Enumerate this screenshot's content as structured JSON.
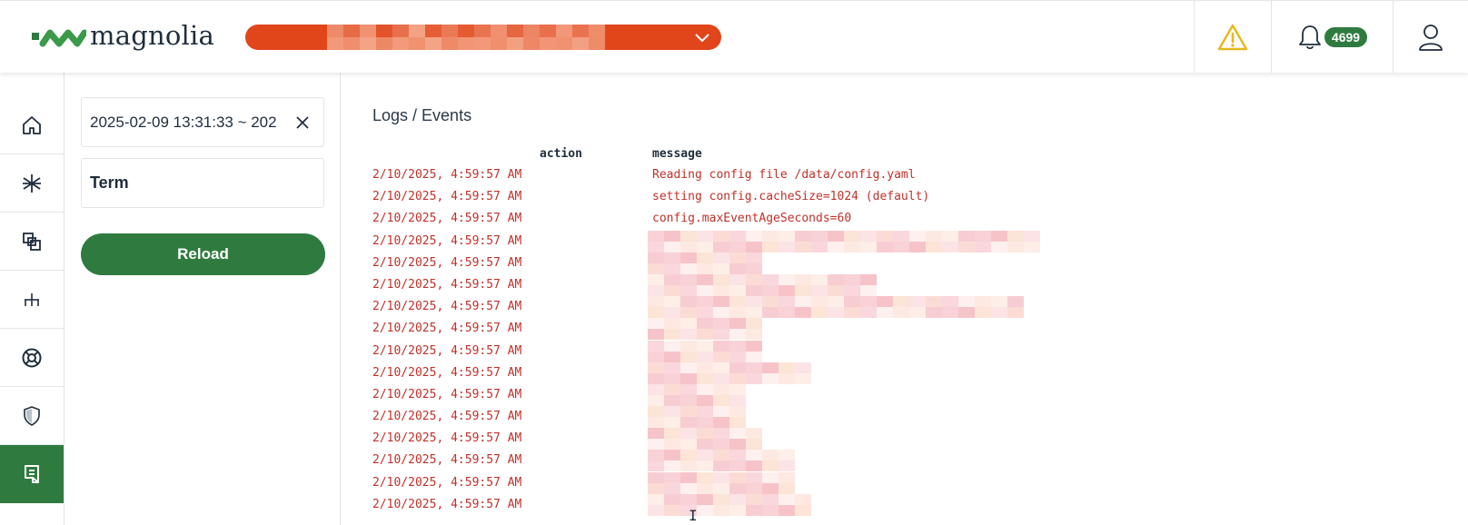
{
  "header": {
    "logo_text": "magnolia",
    "notifications_count": "4699",
    "accent_color": "#2f7b3f",
    "selector_color": "#e1451a",
    "warning_color": "#e5b81a"
  },
  "nav": {
    "items": [
      {
        "icon": "home-icon"
      },
      {
        "icon": "asterisk-icon"
      },
      {
        "icon": "overlap-squares-icon"
      },
      {
        "icon": "hierarchy-icon"
      },
      {
        "icon": "lifebuoy-icon"
      },
      {
        "icon": "shield-icon"
      },
      {
        "icon": "logs-icon",
        "active": true
      }
    ]
  },
  "filters": {
    "date_range": "2025-02-09 13:31:33 ~ 202",
    "term_placeholder": "Term",
    "reload_label": "Reload"
  },
  "main": {
    "breadcrumb": "Logs / Events",
    "columns": {
      "action": "action",
      "message": "message"
    },
    "rows": [
      {
        "timestamp": "2/10/2025, 4:59:57 AM",
        "message": "Reading config file /data/config.yaml"
      },
      {
        "timestamp": "2/10/2025, 4:59:57 AM",
        "message": "setting config.cacheSize=1024 (default)"
      },
      {
        "timestamp": "2/10/2025, 4:59:57 AM",
        "message": "config.maxEventAgeSeconds=60"
      },
      {
        "timestamp": "2/10/2025, 4:59:57 AM",
        "message": ""
      },
      {
        "timestamp": "2/10/2025, 4:59:57 AM",
        "message": ""
      },
      {
        "timestamp": "2/10/2025, 4:59:57 AM",
        "message": ""
      },
      {
        "timestamp": "2/10/2025, 4:59:57 AM",
        "message": ""
      },
      {
        "timestamp": "2/10/2025, 4:59:57 AM",
        "message": ""
      },
      {
        "timestamp": "2/10/2025, 4:59:57 AM",
        "message": ""
      },
      {
        "timestamp": "2/10/2025, 4:59:57 AM",
        "message": ""
      },
      {
        "timestamp": "2/10/2025, 4:59:57 AM",
        "message": ""
      },
      {
        "timestamp": "2/10/2025, 4:59:57 AM",
        "message": ""
      },
      {
        "timestamp": "2/10/2025, 4:59:57 AM",
        "message": ""
      },
      {
        "timestamp": "2/10/2025, 4:59:57 AM",
        "message": ""
      },
      {
        "timestamp": "2/10/2025, 4:59:57 AM",
        "message": ""
      },
      {
        "timestamp": "2/10/2025, 4:59:57 AM",
        "message": ""
      }
    ]
  }
}
